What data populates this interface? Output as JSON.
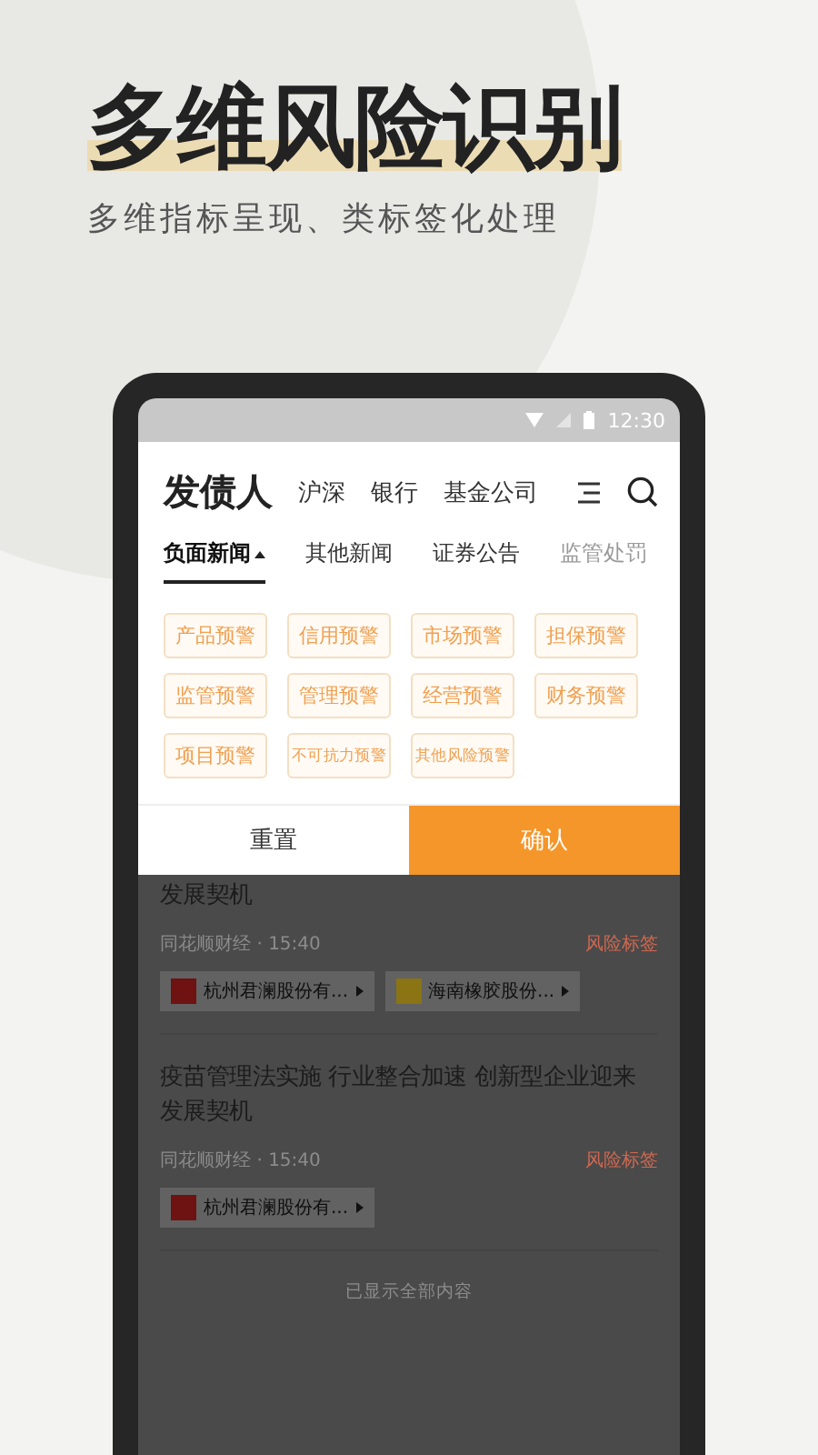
{
  "headline": "多维风险识别",
  "subtitle": "多维指标呈现、类标签化处理",
  "status_bar": {
    "time": "12:30"
  },
  "nav": {
    "title": "发债人",
    "tabs": [
      {
        "label": "沪深"
      },
      {
        "label": "银行"
      },
      {
        "label": "基金公司"
      }
    ]
  },
  "sub_tabs": [
    {
      "label": "负面新闻",
      "selected": true
    },
    {
      "label": "其他新闻",
      "selected": false
    },
    {
      "label": "证券公告",
      "selected": false
    },
    {
      "label": "监管处罚",
      "selected": false
    }
  ],
  "filter_tags": [
    {
      "label": "产品预警"
    },
    {
      "label": "信用预警"
    },
    {
      "label": "市场预警"
    },
    {
      "label": "担保预警"
    },
    {
      "label": "监管预警"
    },
    {
      "label": "管理预警"
    },
    {
      "label": "经营预警"
    },
    {
      "label": "财务预警"
    },
    {
      "label": "项目预警"
    },
    {
      "label": "不可抗力预警"
    },
    {
      "label": "其他风险预警"
    }
  ],
  "buttons": [
    {
      "label": "重置",
      "kind": "secondary"
    },
    {
      "label": "确认",
      "kind": "primary"
    }
  ],
  "news": [
    {
      "title": "发展契机",
      "source": "同花顺财经",
      "separator": "·",
      "time": "15:40",
      "risk_label": "风险标签",
      "companies": [
        {
          "name": "杭州君澜股份有...",
          "color": "#6e1212"
        },
        {
          "name": "海南橡胶股份...",
          "color": "#8a7414"
        }
      ]
    },
    {
      "title": "疫苗管理法实施 行业整合加速 创新型企业迎来发展契机",
      "source": "同花顺财经",
      "separator": "·",
      "time": "15:40",
      "risk_label": "风险标签",
      "companies": [
        {
          "name": "杭州君澜股份有...",
          "color": "#6e1212"
        }
      ]
    }
  ],
  "footer_note": "已显示全部内容"
}
